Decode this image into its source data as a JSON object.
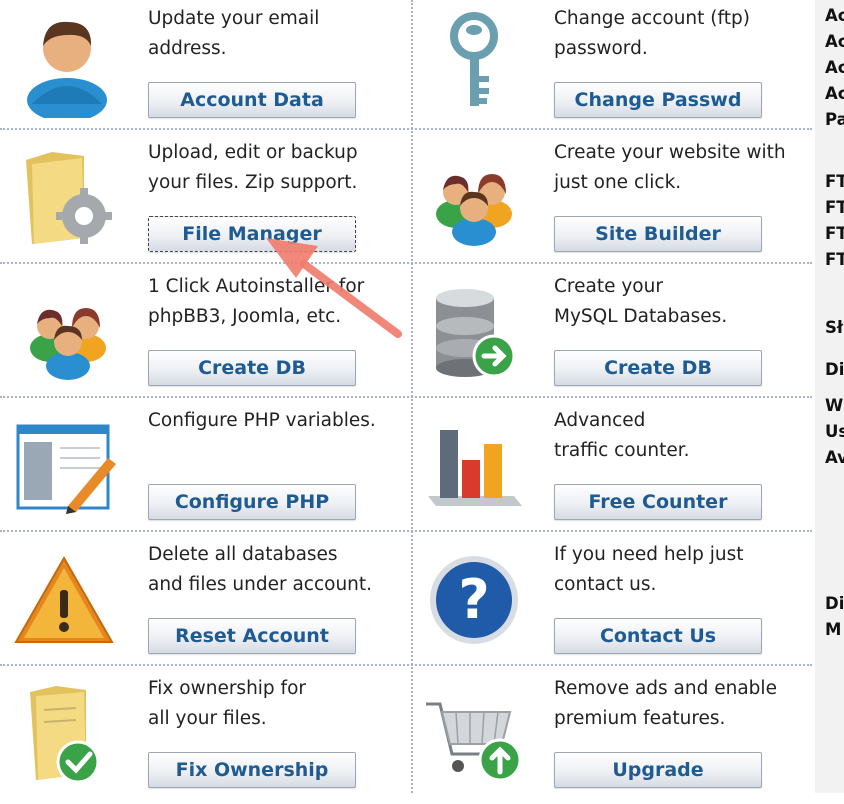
{
  "cells": [
    {
      "desc1": "Update your email",
      "desc2": "address.",
      "button": "Account Data",
      "icon": "user-icon"
    },
    {
      "desc1": "Change account (ftp)",
      "desc2": "password.",
      "button": "Change Passwd",
      "icon": "key-icon"
    },
    {
      "desc1": "Upload, edit or backup",
      "desc2": "your files. Zip support.",
      "button": "File Manager",
      "icon": "folder-gear-icon"
    },
    {
      "desc1": "Create your website with",
      "desc2": "just one click.",
      "button": "Site Builder",
      "icon": "people-icon"
    },
    {
      "desc1": "1 Click Autoinstaller for",
      "desc2": "phpBB3, Joomla, etc.",
      "button": "Create DB",
      "icon": "people-icon"
    },
    {
      "desc1": "Create your",
      "desc2": "MySQL Databases.",
      "button": "Create DB",
      "icon": "database-icon"
    },
    {
      "desc1": "Configure PHP variables.",
      "desc2": "",
      "button": "Configure PHP",
      "icon": "edit-window-icon"
    },
    {
      "desc1": "Advanced",
      "desc2": "traffic counter.",
      "button": "Free Counter",
      "icon": "bar-chart-icon"
    },
    {
      "desc1": "Delete all databases",
      "desc2": "and files under account.",
      "button": "Reset Account",
      "icon": "warning-icon"
    },
    {
      "desc1": "If you need help just",
      "desc2": "contact us.",
      "button": "Contact Us",
      "icon": "help-icon"
    },
    {
      "desc1": "Fix ownership for",
      "desc2": "all your files.",
      "button": "Fix Ownership",
      "icon": "folder-check-icon"
    },
    {
      "desc1": "Remove ads and enable",
      "desc2": "premium features.",
      "button": "Upgrade",
      "icon": "cart-upload-icon"
    }
  ],
  "right_panel": [
    "Ac",
    "Ac",
    "Ac",
    "Ac",
    "Pa",
    "FT",
    "FT",
    "FT",
    "FT",
    "Sł",
    "Di",
    "W",
    "Us",
    "Av",
    "Di",
    "M"
  ],
  "colors": {
    "button_text": "#1f5b93",
    "arrow": "#f07b6b",
    "separator": "#aab3c4"
  }
}
